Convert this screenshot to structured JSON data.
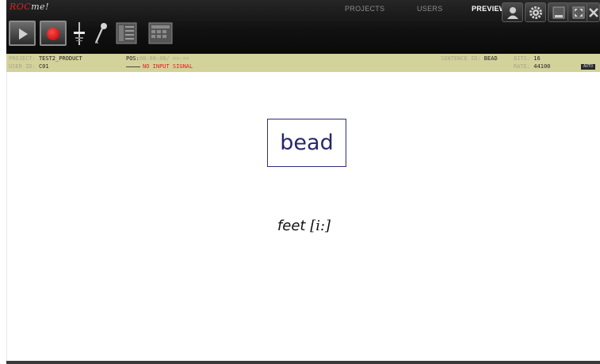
{
  "app": {
    "logo_main": "ROC",
    "logo_sub": "me",
    "logo_bang": "!"
  },
  "toolbar": {
    "play_icon": "play-icon",
    "record_icon": "record-icon",
    "level_icon": "level-slider-icon",
    "mic_icon": "microphone-icon",
    "list_icon": "list-icon",
    "form_icon": "form-icon"
  },
  "nav": {
    "projects": "PROJECTS",
    "users": "USERS",
    "preview": "PREVIEW"
  },
  "window_controls": [
    "person-icon",
    "gear-icon",
    "minimize-icon",
    "fullscreen-icon",
    "close-icon"
  ],
  "status": {
    "project_label": "PROJECT:",
    "project_value": "TEST2_PRODUCT",
    "user_label": "USER ID:",
    "user_value": "C01",
    "pos_label": "POS:",
    "pos_value": "00:00:00/",
    "pos_dashes": "==:==",
    "signal_text": "NO INPUT SIGNAL",
    "sentence_label": "SENTENCE ID:",
    "sentence_value": "BEAD",
    "bits_label": "BITS:",
    "bits_value": "16",
    "rate_label": "RATE:",
    "rate_value": "44100",
    "badge": "AUTO"
  },
  "prompt": {
    "word": "bead",
    "example_word": "feet",
    "example_phoneme": "[i:]"
  },
  "colors": {
    "status_bg": "#d4d29b",
    "word_color": "#26266e",
    "record_red": "#e00000",
    "warning_red": "#e41c1c"
  }
}
